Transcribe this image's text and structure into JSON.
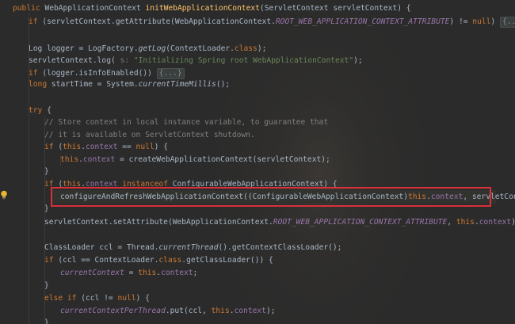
{
  "code": {
    "l1": {
      "a": "public ",
      "b": "WebApplicationContext ",
      "c": "initWebApplicationContext",
      "d": "(ServletContext servletContext) {"
    },
    "l2": {
      "a": "if ",
      "b": "(servletContext.getAttribute(WebApplicationContext.",
      "c": "ROOT_WEB_APPLICATION_CONTEXT_ATTRIBUTE",
      "d": ") != ",
      "e": "null",
      "f": ") ",
      "g": "{...}"
    },
    "l4": {
      "a": "Log logger = LogFactory.",
      "b": "getLog",
      "c": "(ContextLoader.",
      "d": "class",
      "e": ");"
    },
    "l5": {
      "a": "servletContext.log( ",
      "b": "s: ",
      "c": "\"Initializing Spring root WebApplicationContext\"",
      "d": ");"
    },
    "l6": {
      "a": "if ",
      "b": "(logger.isInfoEnabled()) ",
      "c": "{...}"
    },
    "l7": {
      "a": "long ",
      "b": "startTime = System.",
      "c": "currentTimeMillis",
      "d": "();"
    },
    "l9": {
      "a": "try ",
      "b": "{"
    },
    "l10": {
      "a": "// Store context in local instance variable, to guarantee that"
    },
    "l11": {
      "a": "// it is available on ServletContext shutdown."
    },
    "l12": {
      "a": "if ",
      "b": "(",
      "c": "this",
      "d": ".",
      "e": "context",
      "f": " == ",
      "g": "null",
      "h": ") {"
    },
    "l13": {
      "a": "this",
      "b": ".",
      "c": "context",
      "d": " = createWebApplicationContext(servletContext);"
    },
    "l14": {
      "a": "}"
    },
    "l15": {
      "a": "if ",
      "b": "(",
      "c": "this",
      "d": ".",
      "e": "context",
      "f": " ",
      "g": "instanceof ",
      "h": "ConfigurableWebApplicationContext) {"
    },
    "l16": {
      "a": "configureAndRefreshWebApplicationContext((ConfigurableWebApplicationContext)",
      "b": "this",
      "c": ".",
      "d": "context",
      "e": ", servletContext);"
    },
    "l17": {
      "a": "}"
    },
    "l18": {
      "a": "servletContext.setAttribute(WebApplicationContext.",
      "b": "ROOT_WEB_APPLICATION_CONTEXT_ATTRIBUTE",
      "c": ", ",
      "d": "this",
      "e": ".",
      "f": "context",
      "g": ");"
    },
    "l20": {
      "a": "ClassLoader ccl = Thread.",
      "b": "currentThread",
      "c": "().getContextClassLoader();"
    },
    "l21": {
      "a": "if ",
      "b": "(ccl == ContextLoader.",
      "c": "class",
      "d": ".getClassLoader()) {"
    },
    "l22": {
      "a": "currentContext",
      "b": " = ",
      "c": "this",
      "d": ".",
      "e": "context",
      "f": ";"
    },
    "l23": {
      "a": "}"
    },
    "l24": {
      "a": "else if ",
      "b": "(ccl != ",
      "c": "null",
      "d": ") {"
    },
    "l25": {
      "a": "currentContextPerThread",
      "b": ".put(ccl, ",
      "c": "this",
      "d": ".",
      "e": "context",
      "f": ");"
    },
    "l26": {
      "a": "}"
    }
  },
  "colors": {
    "background": "#2b2b2b",
    "keyword": "#cc7832",
    "method_decl": "#ffc66d",
    "field": "#9876aa",
    "string": "#6a8759",
    "comment": "#808080",
    "annotation_box": "#d9303a"
  },
  "icons": {
    "gutter_bulb": "lightbulb-icon"
  }
}
